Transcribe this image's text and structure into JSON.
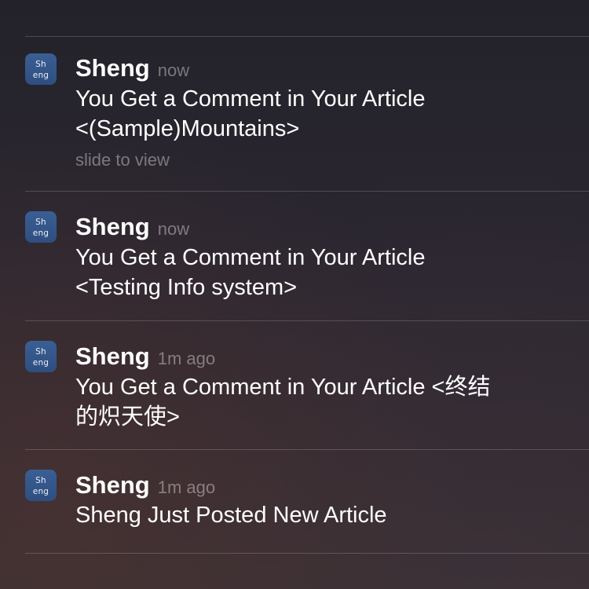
{
  "notifications": [
    {
      "icon_text_top": "Sh",
      "icon_text_bottom": "eng",
      "sender": "Sheng",
      "time": "now",
      "message_line1": "You Get a Comment in Your Article",
      "message_line2": "<(Sample)Mountains>",
      "hint": "slide to view"
    },
    {
      "icon_text_top": "Sh",
      "icon_text_bottom": "eng",
      "sender": "Sheng",
      "time": "now",
      "message_line1": "You Get a Comment in Your Article",
      "message_line2": "<Testing Info system>"
    },
    {
      "icon_text_top": "Sh",
      "icon_text_bottom": "eng",
      "sender": "Sheng",
      "time": "1m ago",
      "message_line1": "You Get a Comment in Your Article <终结",
      "message_line2": "的炽天使>"
    },
    {
      "icon_text_top": "Sh",
      "icon_text_bottom": "eng",
      "sender": "Sheng",
      "time": "1m ago",
      "message_line1": "Sheng Just Posted New Article"
    }
  ],
  "colors": {
    "icon_background": "#2e4e80",
    "divider": "rgba(255,255,255,0.18)",
    "secondary_text": "rgba(255,255,255,0.38)"
  }
}
